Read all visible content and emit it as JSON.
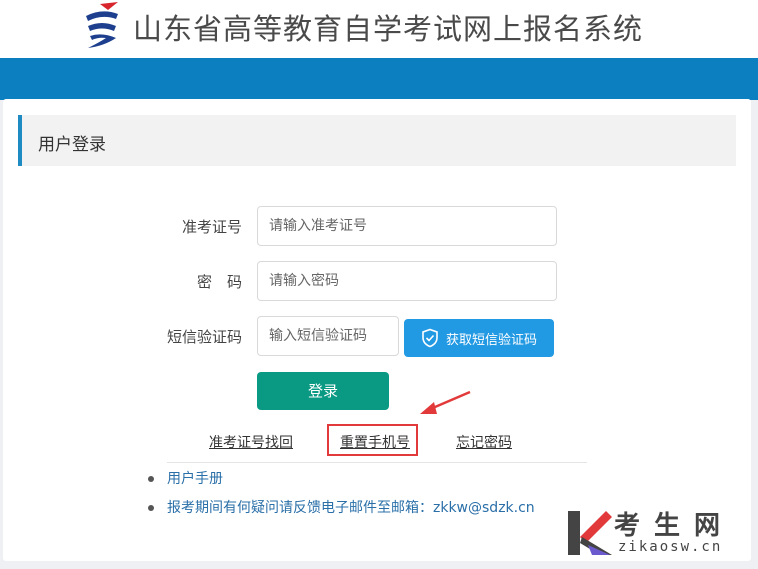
{
  "header": {
    "title": "山东省高等教育自学考试网上报名系统",
    "logo_icon": "sdzk-logo-icon"
  },
  "panel": {
    "title": "用户登录"
  },
  "form": {
    "exam_id": {
      "label": "准考证号",
      "placeholder": "请输入准考证号"
    },
    "password": {
      "label": "密　码",
      "placeholder": "请输入密码"
    },
    "sms": {
      "label": "短信验证码",
      "placeholder": "输入短信验证码",
      "button": "获取短信验证码",
      "button_icon": "shield-check-icon"
    },
    "login_button": "登录"
  },
  "links": {
    "retrieve_id": "准考证号找回",
    "reset_phone": "重置手机号",
    "forgot_password": "忘记密码"
  },
  "info": {
    "items": [
      "用户手册",
      "报考期间有何疑问请反馈电子邮件至邮箱：zkkw@sdzk.cn"
    ]
  },
  "watermark": {
    "brand": "考生网",
    "domain": "zikaosw.cn"
  },
  "colors": {
    "header_bar": "#0b7fc0",
    "sms_button": "#2299e3",
    "login_button": "#0a9a83",
    "highlight": "#e23a3a",
    "link_blue": "#2a6fa8"
  }
}
